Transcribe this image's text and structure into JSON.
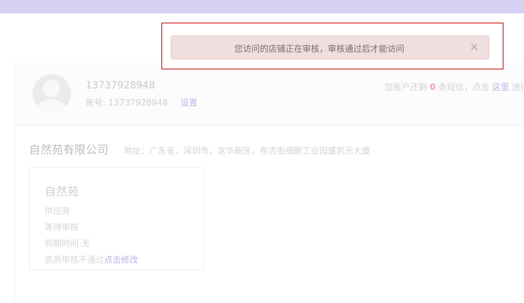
{
  "user": {
    "phone": "13737928948",
    "account_label": "账号:",
    "account_value": "13737928948",
    "settings_label": "设置"
  },
  "sms_notice": {
    "prefix": "您账户还剩",
    "count": "0",
    "middle": "条短信，点击",
    "link_label": "这里",
    "suffix": "进行"
  },
  "company": {
    "name": "自然苑有限公司",
    "address_label": "地址：",
    "address": "广东省，深圳市，龙华新区，布吉街细眼工业园盛凯元大厦"
  },
  "store": {
    "name": "自然苑",
    "type": "供应商",
    "status": "等待审核",
    "expiry": "到期时间:无",
    "review_prefix": "资质审核不通过",
    "review_link": "点击修改"
  },
  "alert": {
    "message": "您访问的店铺正在审核，审核通过后才能访问",
    "close_symbol": "×"
  },
  "colors": {
    "topbar": "#d5d1f5",
    "link": "#b7b4ea",
    "alert_bg": "#f1dede",
    "alert_frame": "#c40000"
  }
}
